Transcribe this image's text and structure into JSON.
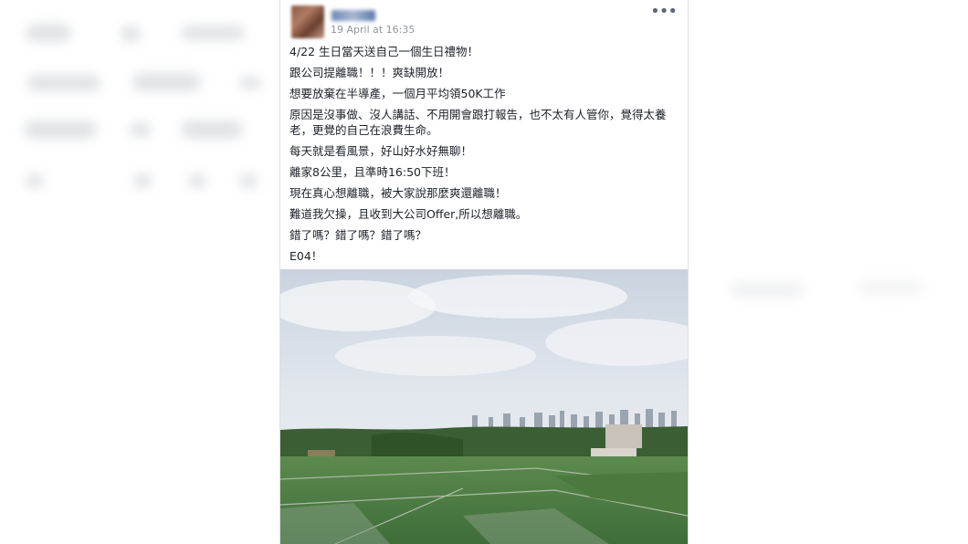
{
  "post": {
    "timestamp": "19 April at 16:35",
    "more_icon": "more-horizontal-icon",
    "lines": [
      "4/22 生日當天送自己一個生日禮物！",
      "跟公司提離職！！！爽缺開放！",
      "想要放棄在半導產，一個月平均領50K工作",
      "原因是沒事做、沒人講話、不用開會跟打報告，也不太有人管你，覺得太養老，更覺的自己在浪費生命。",
      "每天就是看風景，好山好水好無聊！",
      "離家8公里，且準時16:50下班！",
      "現在真心想離職，被大家說那麼爽還離職！",
      "難道我欠操，且收到大公司Offer,所以想離職。",
      "錯了嗎？錯了嗎？錯了嗎？",
      "E04！"
    ]
  },
  "colors": {
    "text": "#1d2129",
    "timestamp": "#90949c",
    "sky": "#dfe6ee",
    "field": "#4d7a45"
  }
}
